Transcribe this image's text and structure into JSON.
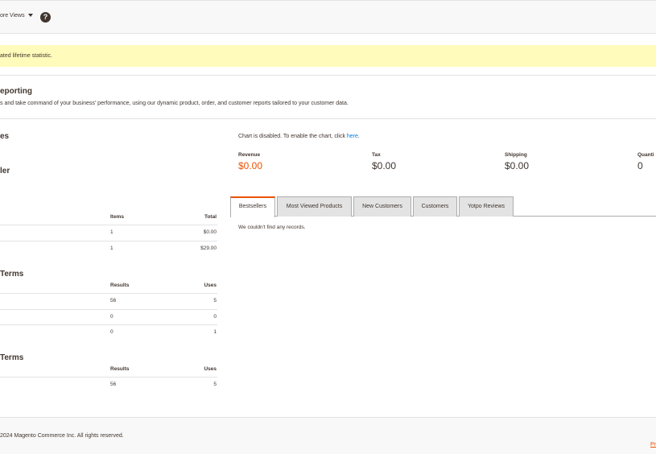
{
  "header": {
    "store_views_label": "ore Views",
    "help_glyph": "?"
  },
  "notice": {
    "text": "ated lifetime statistic."
  },
  "reporting": {
    "title": "eporting",
    "description": "s and take command of your business' performance, using our dynamic product, order, and customer reports tailored to your customer data."
  },
  "left": {
    "sales_title": "es",
    "order_title": "ler",
    "orders_table": {
      "headers": [
        "Items",
        "Total"
      ],
      "rows": [
        {
          "items": "1",
          "total": "$0.00"
        },
        {
          "items": "1",
          "total": "$29.00"
        }
      ]
    },
    "search_terms_title": "Terms",
    "search_terms_table": {
      "headers": [
        "Results",
        "Uses"
      ],
      "rows": [
        {
          "results": "56",
          "uses": "5"
        },
        {
          "results": "0",
          "uses": "0"
        },
        {
          "results": "0",
          "uses": "1"
        }
      ]
    },
    "top_terms_title": "Terms",
    "top_terms_table": {
      "headers": [
        "Results",
        "Uses"
      ],
      "rows": [
        {
          "results": "56",
          "uses": "5"
        }
      ]
    }
  },
  "chart": {
    "disabled_text": "Chart is disabled. To enable the chart, click ",
    "link_text": "here",
    "suffix": "."
  },
  "metrics": [
    {
      "label": "Revenue",
      "value": "$0.00"
    },
    {
      "label": "Tax",
      "value": "$0.00"
    },
    {
      "label": "Shipping",
      "value": "$0.00"
    },
    {
      "label": "Quanti",
      "value": "0"
    }
  ],
  "tabs": [
    {
      "label": "Bestsellers"
    },
    {
      "label": "Most Viewed Products"
    },
    {
      "label": "New Customers"
    },
    {
      "label": "Customers"
    },
    {
      "label": "Yotpo Reviews"
    }
  ],
  "tab_content": {
    "empty_text": "We couldn't find any records."
  },
  "footer": {
    "copyright": "2024 Magento Commerce Inc. All rights reserved.",
    "corner_link": "Pr"
  },
  "colors": {
    "accent": "#eb5202",
    "link": "#007bdb",
    "notice_bg": "#fffbbb",
    "text": "#41362f"
  }
}
